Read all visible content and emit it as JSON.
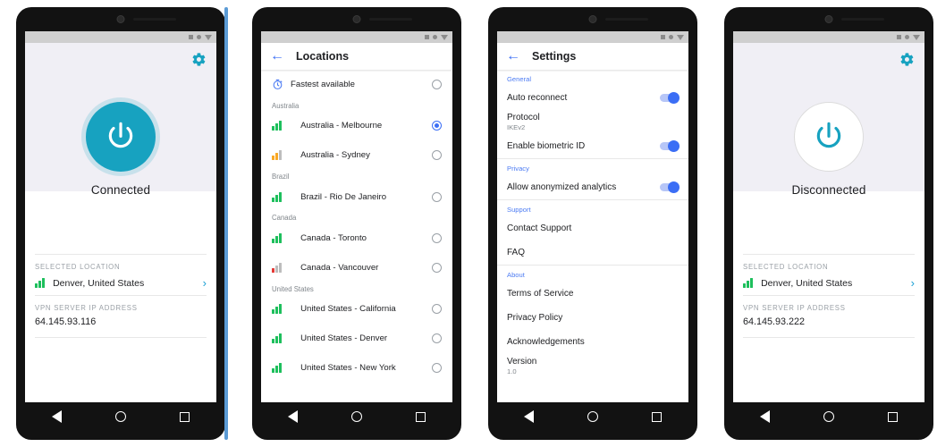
{
  "app": {
    "accent_teal": "#17A2C0",
    "accent_blue": "#3b6ef5",
    "signal_green": "#1DBF5C",
    "signal_orange": "#F9A825",
    "signal_red": "#E53935",
    "signal_gray": "#BDBDBD"
  },
  "status_bar": {
    "icons": [
      "square-icon",
      "circle-icon",
      "triangle-icon"
    ]
  },
  "nav_bar": {
    "back": "back-triangle-icon",
    "home": "home-circle-icon",
    "recents": "recents-square-icon"
  },
  "screen1": {
    "name": "vpn-home-connected",
    "gear_icon": "gear-icon",
    "power_icon": "power-icon",
    "status_text": "Connected",
    "connected": true,
    "selected_location_caption": "SELECTED LOCATION",
    "selected_location": "Denver, United States",
    "selected_location_signal": "green",
    "chevron": "›",
    "ip_caption": "VPN SERVER IP ADDRESS",
    "ip_value": "64.145.93.116"
  },
  "screen2": {
    "name": "locations",
    "back_icon": "arrow-back-icon",
    "title": "Locations",
    "fastest": {
      "label": "Fastest available",
      "icon": "stopwatch-icon",
      "selected": false
    },
    "groups": [
      {
        "name": "Australia",
        "items": [
          {
            "label": "Australia - Melbourne",
            "signal": "green",
            "selected": true
          },
          {
            "label": "Australia - Sydney",
            "signal": "orange",
            "selected": false
          }
        ]
      },
      {
        "name": "Brazil",
        "items": [
          {
            "label": "Brazil - Rio De Janeiro",
            "signal": "green",
            "selected": false
          }
        ]
      },
      {
        "name": "Canada",
        "items": [
          {
            "label": "Canada - Toronto",
            "signal": "green",
            "selected": false
          },
          {
            "label": "Canada - Vancouver",
            "signal": "red",
            "selected": false
          }
        ]
      },
      {
        "name": "United States",
        "items": [
          {
            "label": "United States - California",
            "signal": "green",
            "selected": false
          },
          {
            "label": "United States - Denver",
            "signal": "green",
            "selected": false
          },
          {
            "label": "United States - New York",
            "signal": "green",
            "selected": false
          }
        ]
      }
    ]
  },
  "screen3": {
    "name": "settings",
    "back_icon": "arrow-back-icon",
    "title": "Settings",
    "sections": [
      {
        "header": "General",
        "rows": [
          {
            "label": "Auto reconnect",
            "sub": "",
            "control": "toggle",
            "on": true
          },
          {
            "label": "Protocol",
            "sub": "IKEv2",
            "control": "none"
          },
          {
            "label": "Enable biometric ID",
            "sub": "",
            "control": "toggle",
            "on": true
          }
        ]
      },
      {
        "header": "Privacy",
        "rows": [
          {
            "label": "Allow anonymized analytics",
            "sub": "",
            "control": "toggle",
            "on": true
          }
        ]
      },
      {
        "header": "Support",
        "rows": [
          {
            "label": "Contact Support",
            "sub": "",
            "control": "none"
          },
          {
            "label": "FAQ",
            "sub": "",
            "control": "none"
          }
        ]
      },
      {
        "header": "About",
        "rows": [
          {
            "label": "Terms of Service",
            "sub": "",
            "control": "none"
          },
          {
            "label": "Privacy Policy",
            "sub": "",
            "control": "none"
          },
          {
            "label": "Acknowledgements",
            "sub": "",
            "control": "none"
          },
          {
            "label": "Version",
            "sub": "1.0",
            "control": "none"
          }
        ]
      }
    ]
  },
  "screen4": {
    "name": "vpn-home-disconnected",
    "gear_icon": "gear-icon",
    "power_icon": "power-icon",
    "status_text": "Disconnected",
    "connected": false,
    "selected_location_caption": "SELECTED LOCATION",
    "selected_location": "Denver, United States",
    "selected_location_signal": "green",
    "chevron": "›",
    "ip_caption": "VPN SERVER IP ADDRESS",
    "ip_value": "64.145.93.222"
  }
}
